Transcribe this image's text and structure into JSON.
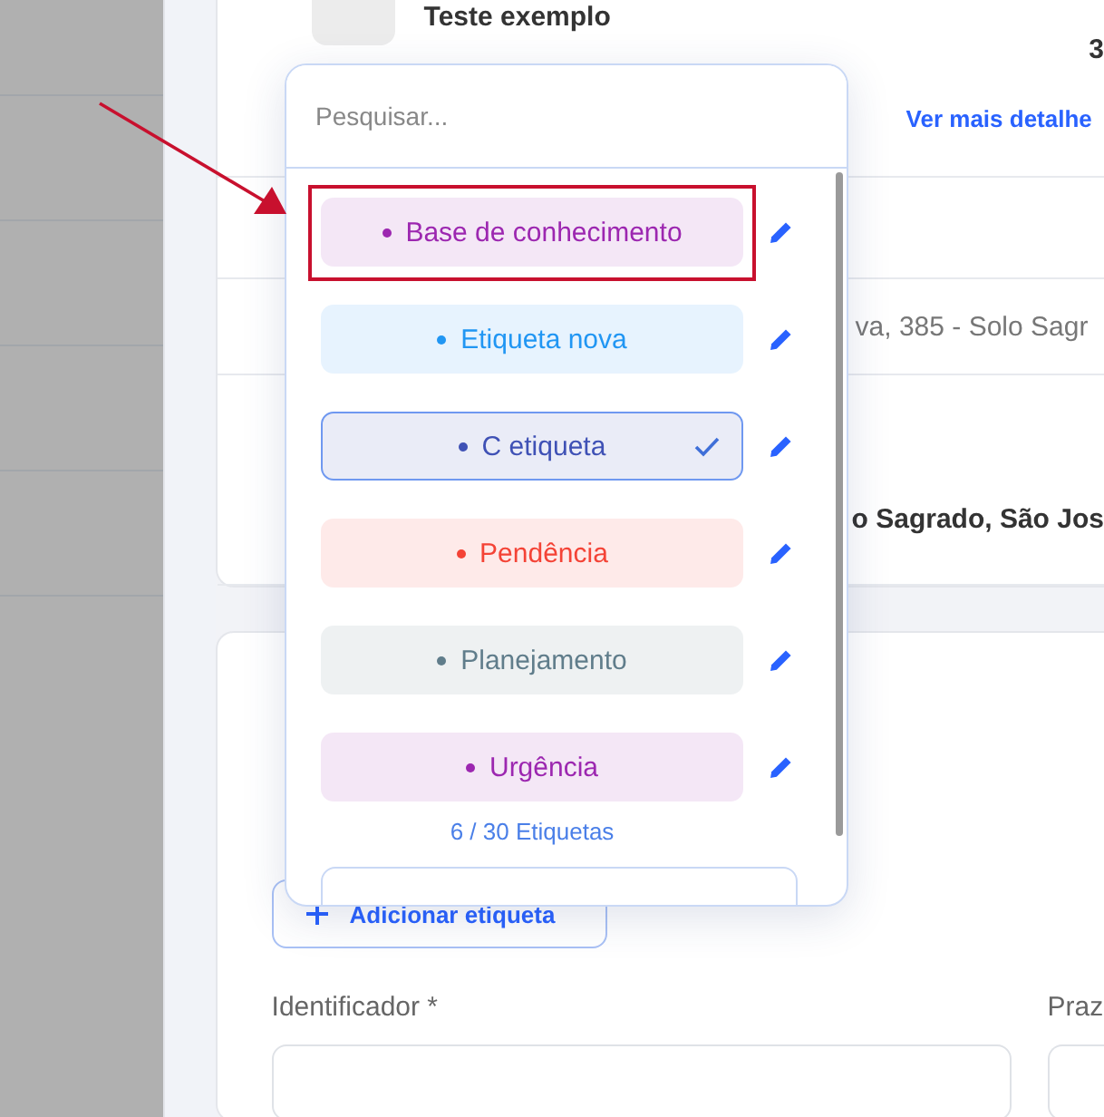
{
  "record": {
    "title": "Teste exemplo",
    "value": "3",
    "link": "Ver mais detalhe",
    "address": "va, 385 - Solo Sagr",
    "city": "o Sagrado, São Jos"
  },
  "tag_popup": {
    "search": {
      "placeholder": "Pesquisar..."
    },
    "tags": [
      {
        "label": "Base de conhecimento",
        "color": "#9c27b0",
        "selected": false,
        "highlighted": true
      },
      {
        "label": "Etiqueta nova",
        "color": "#2196f3",
        "selected": false,
        "highlighted": false
      },
      {
        "label": "C etiqueta",
        "color": "#3f51b5",
        "selected": true,
        "highlighted": false
      },
      {
        "label": "Pendência",
        "color": "#f44336",
        "selected": false,
        "highlighted": false
      },
      {
        "label": "Planejamento",
        "color": "#607d8b",
        "selected": false,
        "highlighted": false
      },
      {
        "label": "Urgência",
        "color": "#9c27b0",
        "selected": false,
        "highlighted": false
      }
    ],
    "counter": "6 / 30 Etiquetas"
  },
  "form": {
    "add_tag_button": "Adicionar etiqueta",
    "fields": [
      {
        "label": "Identificador *"
      },
      {
        "label": "Praz"
      }
    ]
  }
}
